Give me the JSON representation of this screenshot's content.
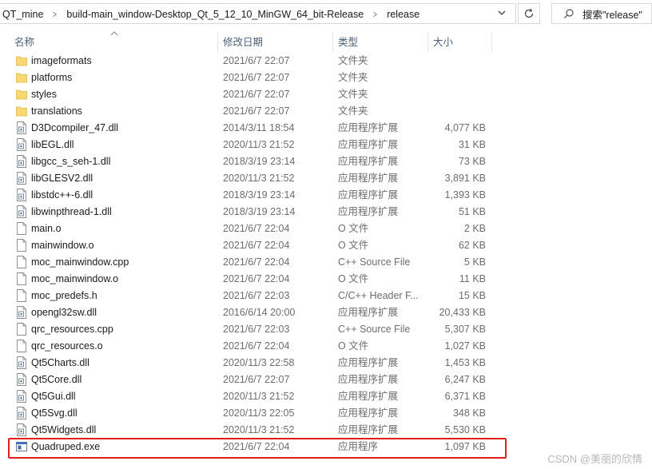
{
  "breadcrumb": [
    "QT_mine",
    "build-main_window-Desktop_Qt_5_12_10_MinGW_64_bit-Release",
    "release"
  ],
  "search": {
    "placeholder": "搜索\"release\""
  },
  "columns": {
    "name": "名称",
    "date": "修改日期",
    "type": "类型",
    "size": "大小"
  },
  "files": [
    {
      "name": "imageformats",
      "date": "2021/6/7 22:07",
      "type": "文件夹",
      "size": "",
      "icon": "folder-icon"
    },
    {
      "name": "platforms",
      "date": "2021/6/7 22:07",
      "type": "文件夹",
      "size": "",
      "icon": "folder-icon"
    },
    {
      "name": "styles",
      "date": "2021/6/7 22:07",
      "type": "文件夹",
      "size": "",
      "icon": "folder-icon"
    },
    {
      "name": "translations",
      "date": "2021/6/7 22:07",
      "type": "文件夹",
      "size": "",
      "icon": "folder-icon"
    },
    {
      "name": "D3Dcompiler_47.dll",
      "date": "2014/3/11 18:54",
      "type": "应用程序扩展",
      "size": "4,077 KB",
      "icon": "dll-file-icon"
    },
    {
      "name": "libEGL.dll",
      "date": "2020/11/3 21:52",
      "type": "应用程序扩展",
      "size": "31 KB",
      "icon": "dll-file-icon"
    },
    {
      "name": "libgcc_s_seh-1.dll",
      "date": "2018/3/19 23:14",
      "type": "应用程序扩展",
      "size": "73 KB",
      "icon": "dll-file-icon"
    },
    {
      "name": "libGLESV2.dll",
      "date": "2020/11/3 21:52",
      "type": "应用程序扩展",
      "size": "3,891 KB",
      "icon": "dll-file-icon"
    },
    {
      "name": "libstdc++-6.dll",
      "date": "2018/3/19 23:14",
      "type": "应用程序扩展",
      "size": "1,393 KB",
      "icon": "dll-file-icon"
    },
    {
      "name": "libwinpthread-1.dll",
      "date": "2018/3/19 23:14",
      "type": "应用程序扩展",
      "size": "51 KB",
      "icon": "dll-file-icon"
    },
    {
      "name": "main.o",
      "date": "2021/6/7 22:04",
      "type": "O 文件",
      "size": "2 KB",
      "icon": "file-icon"
    },
    {
      "name": "mainwindow.o",
      "date": "2021/6/7 22:04",
      "type": "O 文件",
      "size": "62 KB",
      "icon": "file-icon"
    },
    {
      "name": "moc_mainwindow.cpp",
      "date": "2021/6/7 22:04",
      "type": "C++ Source File",
      "size": "5 KB",
      "icon": "file-icon"
    },
    {
      "name": "moc_mainwindow.o",
      "date": "2021/6/7 22:04",
      "type": "O 文件",
      "size": "11 KB",
      "icon": "file-icon"
    },
    {
      "name": "moc_predefs.h",
      "date": "2021/6/7 22:03",
      "type": "C/C++ Header F...",
      "size": "15 KB",
      "icon": "file-icon"
    },
    {
      "name": "opengl32sw.dll",
      "date": "2016/6/14 20:00",
      "type": "应用程序扩展",
      "size": "20,433 KB",
      "icon": "dll-file-icon"
    },
    {
      "name": "qrc_resources.cpp",
      "date": "2021/6/7 22:03",
      "type": "C++ Source File",
      "size": "5,307 KB",
      "icon": "file-icon"
    },
    {
      "name": "qrc_resources.o",
      "date": "2021/6/7 22:04",
      "type": "O 文件",
      "size": "1,027 KB",
      "icon": "file-icon"
    },
    {
      "name": "Qt5Charts.dll",
      "date": "2020/11/3 22:58",
      "type": "应用程序扩展",
      "size": "1,453 KB",
      "icon": "dll-file-icon"
    },
    {
      "name": "Qt5Core.dll",
      "date": "2021/6/7 22:07",
      "type": "应用程序扩展",
      "size": "6,247 KB",
      "icon": "dll-file-icon"
    },
    {
      "name": "Qt5Gui.dll",
      "date": "2020/11/3 21:52",
      "type": "应用程序扩展",
      "size": "6,371 KB",
      "icon": "dll-file-icon"
    },
    {
      "name": "Qt5Svg.dll",
      "date": "2020/11/3 22:05",
      "type": "应用程序扩展",
      "size": "348 KB",
      "icon": "dll-file-icon"
    },
    {
      "name": "Qt5Widgets.dll",
      "date": "2020/11/3 21:52",
      "type": "应用程序扩展",
      "size": "5,530 KB",
      "icon": "dll-file-icon"
    },
    {
      "name": "Quadruped.exe",
      "date": "2021/6/7 22:04",
      "type": "应用程序",
      "size": "1,097 KB",
      "icon": "exe-icon"
    }
  ],
  "watermark": "CSDN @美丽的欣情",
  "colors": {
    "folder": "#f8d775",
    "highlight_border": "#e0201a",
    "header_text": "#4c607a"
  }
}
